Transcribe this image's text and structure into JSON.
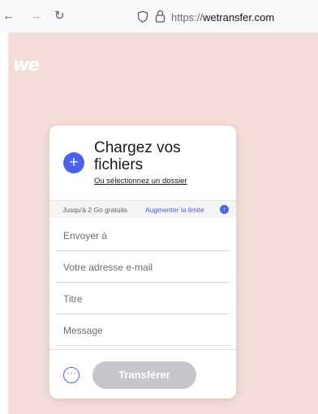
{
  "browser": {
    "back_glyph": "←",
    "forward_glyph": "→",
    "reload_glyph": "↻",
    "url_scheme": "https://",
    "url_host": "wetransfer.com"
  },
  "brand": {
    "logo_text": "we"
  },
  "upload": {
    "title": "Chargez vos fichiers",
    "select_folder": "Ou sélectionnez un dossier",
    "add_glyph": "+"
  },
  "quota": {
    "text": "Jusqu'à 2 Go gratuits",
    "link": "Augmenter la limite",
    "icon_glyph": "↑"
  },
  "form": {
    "send_to_placeholder": "Envoyer à",
    "email_placeholder": "Votre adresse e-mail",
    "title_placeholder": "Titre",
    "message_placeholder": "Message"
  },
  "actions": {
    "more_glyph": "···",
    "transfer_label": "Transférer"
  },
  "colors": {
    "accent": "#4a63e8",
    "page_background": "#f4ddd8",
    "disabled_button": "#c5c6cb"
  }
}
